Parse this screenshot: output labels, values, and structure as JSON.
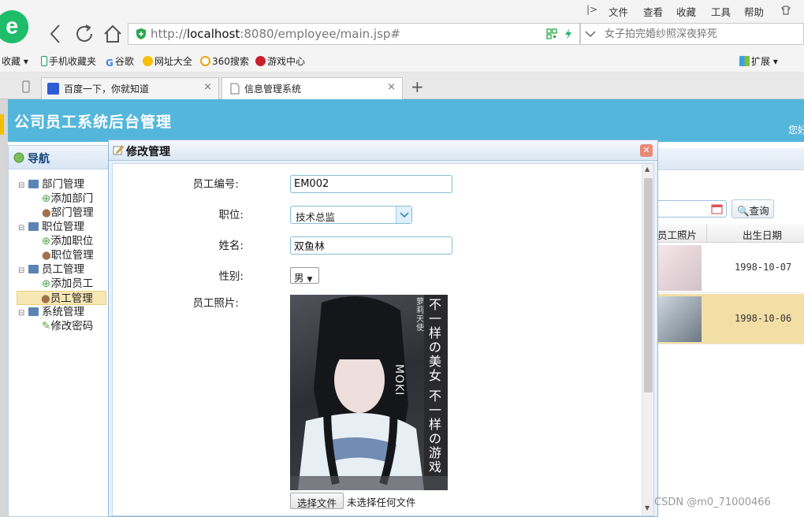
{
  "browser": {
    "menu": [
      "文件",
      "查看",
      "收藏",
      "工具",
      "帮助"
    ],
    "url_prefix": "http://",
    "url_host": "localhost",
    "url_rest": ":8080/employee/main.jsp#",
    "search_placeholder": "女子拍完婚纱照深夜猝死",
    "bookmarks": [
      "收藏",
      "手机收藏夹",
      "谷歌",
      "网址大全",
      "360搜索",
      "游戏中心"
    ],
    "extensions_label": "扩展",
    "tabs": [
      {
        "label": "百度一下，你就知道"
      },
      {
        "label": "信息管理系统"
      }
    ],
    "new_tab_label": "+"
  },
  "app": {
    "title": "公司员工系统后台管理",
    "welcome": "您好"
  },
  "nav": {
    "title": "导航",
    "groups": [
      {
        "label": "部门管理",
        "items": [
          "添加部门",
          "部门管理"
        ]
      },
      {
        "label": "职位管理",
        "items": [
          "添加职位",
          "职位管理"
        ]
      },
      {
        "label": "员工管理",
        "items": [
          "添加员工",
          "员工管理"
        ]
      },
      {
        "label": "系统管理",
        "items": [
          "修改密码"
        ]
      }
    ]
  },
  "grid": {
    "search_button": "查询",
    "col_photo": "员工照片",
    "col_birth": "出生日期",
    "rows": [
      {
        "birth": "1998-10-07"
      },
      {
        "birth": "1998-10-06"
      }
    ]
  },
  "dialog": {
    "title": "修改管理",
    "fields": {
      "emp_no_label": "员工编号:",
      "emp_no_value": "EM002",
      "position_label": "职位:",
      "position_value": "技术总监",
      "name_label": "姓名:",
      "name_value": "双鱼林",
      "gender_label": "性别:",
      "gender_value": "男",
      "photo_label": "员工照片:"
    },
    "photo_text": {
      "line1": "不一样の美女",
      "line2": "不一样の游戏",
      "side": "萝莉天使",
      "brand": "MOKI"
    },
    "file_button": "选择文件",
    "file_status": "未选择任何文件"
  },
  "watermark": "CSDN @m0_71000466",
  "colors": {
    "header": "#55b6dc",
    "selected_row": "#f3dfa6",
    "dialog_border": "#8fb6dd"
  }
}
